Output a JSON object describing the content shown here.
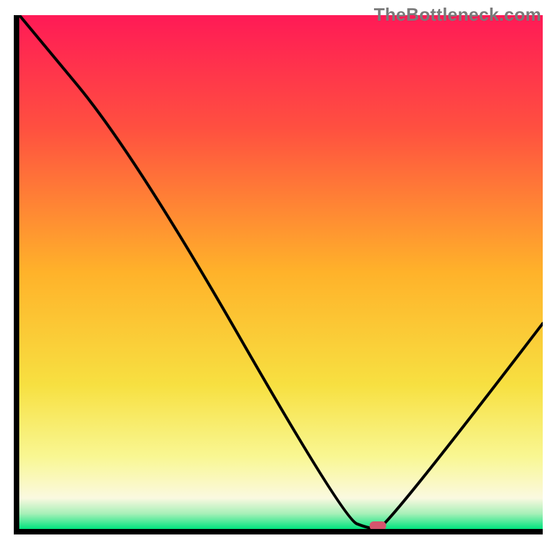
{
  "watermark": "TheBottleneck.com",
  "chart_data": {
    "type": "line",
    "title": "",
    "xlabel": "",
    "ylabel": "",
    "xlim": [
      0,
      100
    ],
    "ylim": [
      0,
      100
    ],
    "x": [
      0.0,
      22.0,
      62.0,
      67.0,
      70.0,
      100.0
    ],
    "values": [
      100.0,
      73.0,
      2.0,
      0.0,
      0.0,
      40.0
    ],
    "marker": {
      "x": 68.5,
      "y": 0.0
    },
    "gradient_stops": [
      {
        "pct": 0,
        "color": "#ff1a56"
      },
      {
        "pct": 22,
        "color": "#ff5040"
      },
      {
        "pct": 50,
        "color": "#ffb22a"
      },
      {
        "pct": 72,
        "color": "#f7e041"
      },
      {
        "pct": 86,
        "color": "#f9f793"
      },
      {
        "pct": 94,
        "color": "#faf9e0"
      },
      {
        "pct": 97,
        "color": "#a8f0b8"
      },
      {
        "pct": 100,
        "color": "#00e47e"
      }
    ]
  }
}
